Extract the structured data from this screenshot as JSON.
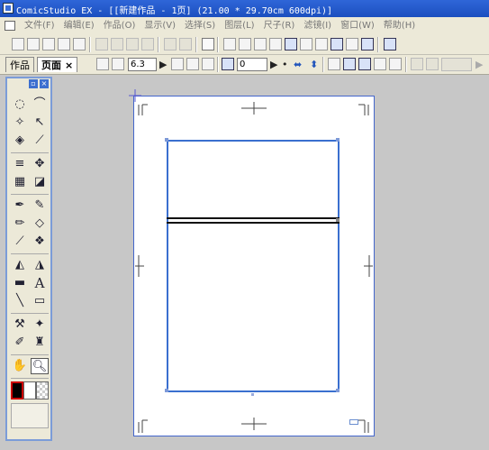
{
  "window": {
    "title": "ComicStudio EX - [[新建作品 - 1页] (21.00 * 29.70cm 600dpi)]"
  },
  "menu": {
    "items": [
      {
        "label": "文件(F)"
      },
      {
        "label": "编辑(E)"
      },
      {
        "label": "作品(O)"
      },
      {
        "label": "显示(V)"
      },
      {
        "label": "选择(S)"
      },
      {
        "label": "图层(L)"
      },
      {
        "label": "尺子(R)"
      },
      {
        "label": "滤镜(I)"
      },
      {
        "label": "窗口(W)"
      },
      {
        "label": "帮助(H)"
      }
    ]
  },
  "toolbar": {
    "tabs": [
      {
        "label": "作品",
        "active": false
      },
      {
        "label": "页面",
        "active": true,
        "close": "×"
      }
    ],
    "line_width_value": "6.3",
    "rotation_value": "0"
  },
  "tool_palette": {
    "tools": [
      "rect-select",
      "lasso-select",
      "magic-wand",
      "select-pointer",
      "layer-select",
      "eyedropper",
      "hatch",
      "move",
      "grid",
      "camera-box",
      "pen",
      "marker",
      "pencil",
      "eraser",
      "brush",
      "airbrush",
      "fill",
      "pattern-fill",
      "gradient",
      "text",
      "curve-ruler",
      "frame-ruler",
      "layer-ops",
      "effects",
      "correction-pen",
      "stamp",
      "hand",
      "zoom"
    ],
    "selected_tool": "zoom",
    "colors": {
      "main": "#000000",
      "sub": "#ffffff",
      "transparent": "transparent"
    }
  },
  "colors": {
    "accent": "#3a6fcf",
    "title_bar": "#2f66d8",
    "workspace": "#c7c7c7"
  }
}
